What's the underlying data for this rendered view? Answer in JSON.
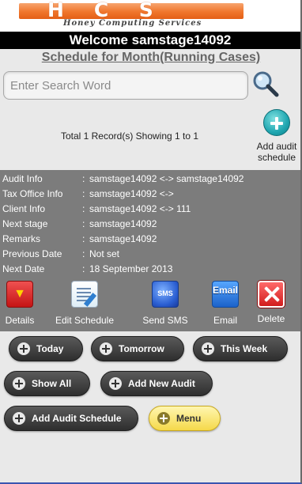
{
  "header": {
    "logo_text": "HCS",
    "logo_subtitle": "Honey Computing Services",
    "welcome": "Welcome samstage14092",
    "page_title": "Schedule for Month(Running Cases)"
  },
  "search": {
    "placeholder": "Enter Search Word",
    "value": ""
  },
  "records": {
    "summary": "Total 1 Record(s) Showing 1 to 1",
    "add_label": "Add audit schedule"
  },
  "details": [
    {
      "key": "Audit Info",
      "sep": ":",
      "value": "samstage14092 <-> samstage14092"
    },
    {
      "key": "Tax Office Info",
      "sep": ":",
      "value": "samstage14092 <->"
    },
    {
      "key": "Client Info",
      "sep": ":",
      "value": "samstage14092 <-> 111"
    },
    {
      "key": "Next stage",
      "sep": ":",
      "value": "samstage14092"
    },
    {
      "key": "Remarks",
      "sep": ":",
      "value": "samstage14092"
    },
    {
      "key": "Previous Date",
      "sep": ":",
      "value": "Not set"
    },
    {
      "key": "Next Date",
      "sep": ":",
      "value": "18 September 2013"
    }
  ],
  "actions": {
    "details": "Details",
    "edit": "Edit Schedule",
    "sms": "Send SMS",
    "email": "Email",
    "delete": "Delete"
  },
  "buttons": {
    "today": "Today",
    "tomorrow": "Tomorrow",
    "this_week": "This Week",
    "show_all": "Show All",
    "add_new_audit": "Add New Audit",
    "add_audit_schedule": "Add Audit Schedule",
    "menu": "Menu"
  },
  "colors": {
    "accent_orange": "#f0762c",
    "details_bg": "#7c7c7c",
    "button_dark": "#3a3a3a",
    "button_yellow": "#f5d94a"
  }
}
